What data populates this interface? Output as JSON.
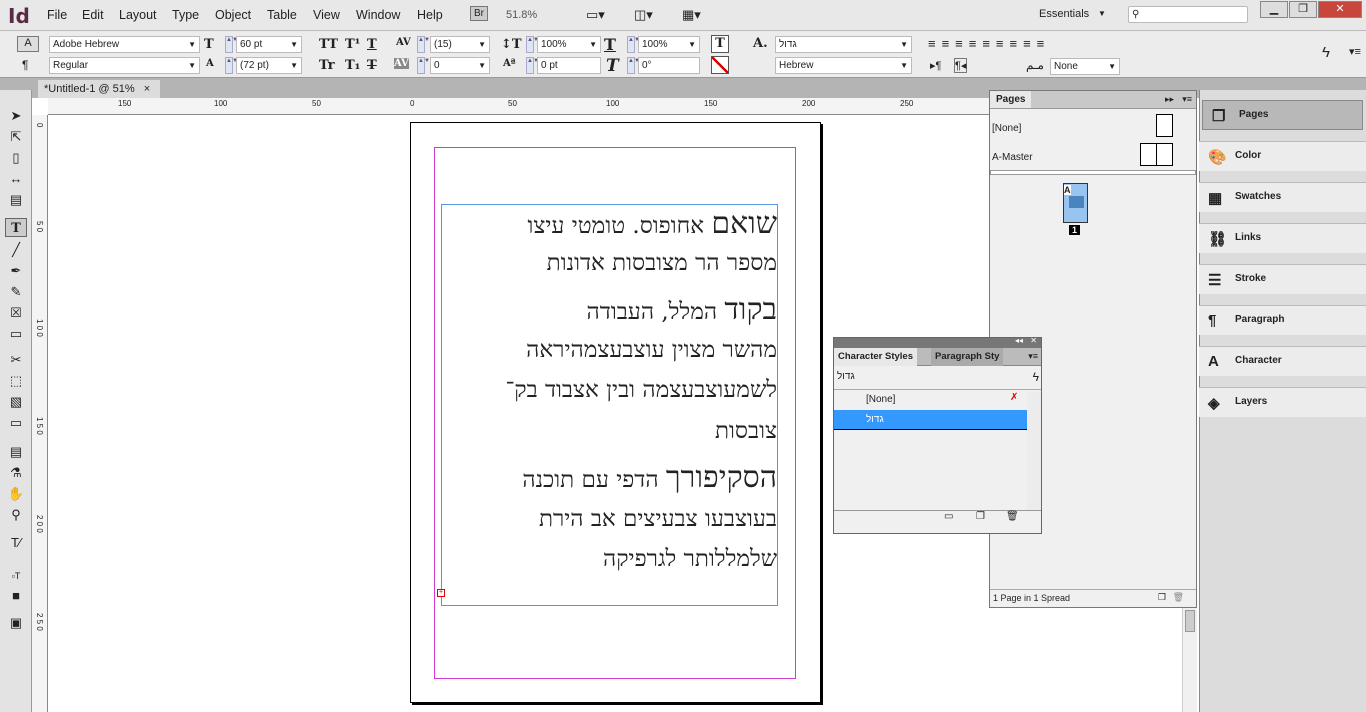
{
  "app": {
    "logo": "Id",
    "menu": [
      "File",
      "Edit",
      "Layout",
      "Type",
      "Object",
      "Table",
      "View",
      "Window",
      "Help"
    ],
    "bridge": "Br",
    "zoom": "51.8%",
    "workspace": "Essentials",
    "search_placeholder": ""
  },
  "control": {
    "font_family": "Adobe Hebrew",
    "font_style": "Regular",
    "font_size": "60 pt",
    "leading": "(72 pt)",
    "kerning": "(15)",
    "tracking": "0",
    "vscale": "100%",
    "hscale": "100%",
    "baseline": "0 pt",
    "skew": "0°",
    "char_style": "גדול",
    "language": "Hebrew",
    "kashida": "None"
  },
  "document": {
    "tab": "*Untitled-1 @ 51%",
    "hruler": [
      "150",
      "100",
      "50",
      "0",
      "50",
      "100",
      "150",
      "200",
      "250"
    ],
    "vruler": [
      "0",
      "5 0",
      "1 0 0",
      "1 5 0",
      "2 0 0",
      "2 5 0"
    ],
    "lines": [
      {
        "big": "שואם",
        "rest": " אחופוס. טומטי עיצו"
      },
      {
        "big": "",
        "rest": "מספר הר מצובסות אדונות"
      },
      {
        "big": "בקוד",
        "rest": " המלל, העבודה"
      },
      {
        "big": "",
        "rest": "מהשר מצוין עוצבעצמהיראה"
      },
      {
        "big": "",
        "rest": "לשמעוצבעצמה ובין אצבוד בק־"
      },
      {
        "big": "",
        "rest": "צובסות"
      },
      {
        "big": "הסקיפורך",
        "rest": " הדפי עם תוכנה"
      },
      {
        "big": "",
        "rest": "בעוצבעו צבעיצים אב הירת"
      },
      {
        "big": "",
        "rest": "שלמללותר לגרפיקה"
      }
    ]
  },
  "pages_panel": {
    "title": "Pages",
    "masters": [
      "[None]",
      "A-Master"
    ],
    "page_number": "1",
    "master_letter": "A",
    "footer": "1 Page in 1 Spread"
  },
  "dock": [
    "Pages",
    "Color",
    "Swatches",
    "Links",
    "Stroke",
    "Paragraph",
    "Character",
    "Layers"
  ],
  "char_styles": {
    "tab1": "Character Styles",
    "tab2": "Paragraph Sty",
    "current": "גדול",
    "items": [
      "[None]",
      "גדול"
    ],
    "selected_color": "#3399ff"
  }
}
